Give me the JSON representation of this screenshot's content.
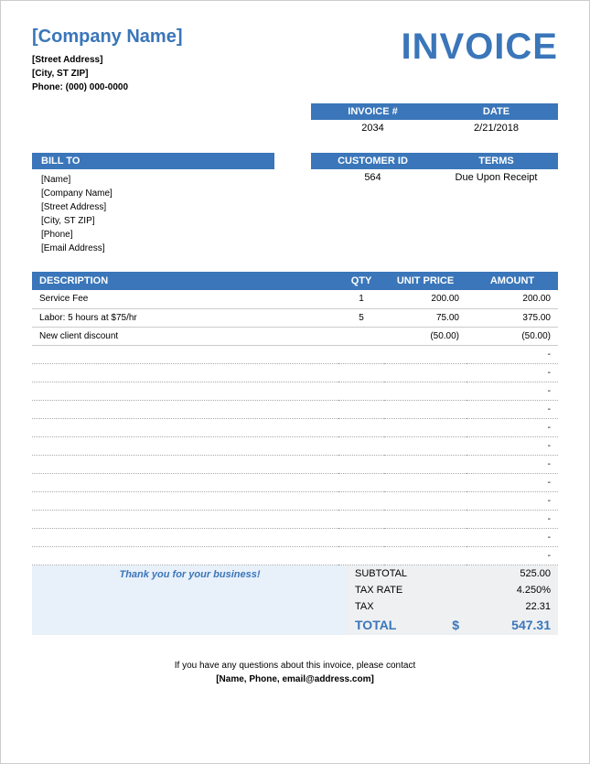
{
  "header": {
    "company_name": "[Company Name]",
    "invoice_title": "INVOICE",
    "street": "[Street Address]",
    "city": "[City, ST  ZIP]",
    "phone": "Phone: (000) 000-0000"
  },
  "meta": {
    "invoice_num_label": "INVOICE #",
    "date_label": "DATE",
    "invoice_num": "2034",
    "date": "2/21/2018",
    "customer_id_label": "CUSTOMER ID",
    "terms_label": "TERMS",
    "customer_id": "564",
    "terms": "Due Upon Receipt"
  },
  "billto": {
    "header": "BILL TO",
    "name": "[Name]",
    "company": "[Company Name]",
    "street": "[Street Address]",
    "city": "[City, ST  ZIP]",
    "phone": "[Phone]",
    "email": "[Email Address]"
  },
  "columns": {
    "description": "DESCRIPTION",
    "qty": "QTY",
    "unit_price": "UNIT PRICE",
    "amount": "AMOUNT"
  },
  "items": [
    {
      "desc": "Service Fee",
      "qty": "1",
      "price": "200.00",
      "amount": "200.00"
    },
    {
      "desc": "Labor: 5 hours at $75/hr",
      "qty": "5",
      "price": "75.00",
      "amount": "375.00"
    },
    {
      "desc": "New client discount",
      "qty": "",
      "price": "(50.00)",
      "amount": "(50.00)"
    }
  ],
  "empty_dash": "-",
  "thanks": "Thank you for your business!",
  "totals": {
    "subtotal_label": "SUBTOTAL",
    "subtotal": "525.00",
    "taxrate_label": "TAX RATE",
    "taxrate": "4.250%",
    "tax_label": "TAX",
    "tax": "22.31",
    "total_label": "TOTAL",
    "dollar": "$",
    "total": "547.31"
  },
  "footer": {
    "line1": "If you have any questions about this invoice, please contact",
    "line2": "[Name, Phone, email@address.com]"
  }
}
